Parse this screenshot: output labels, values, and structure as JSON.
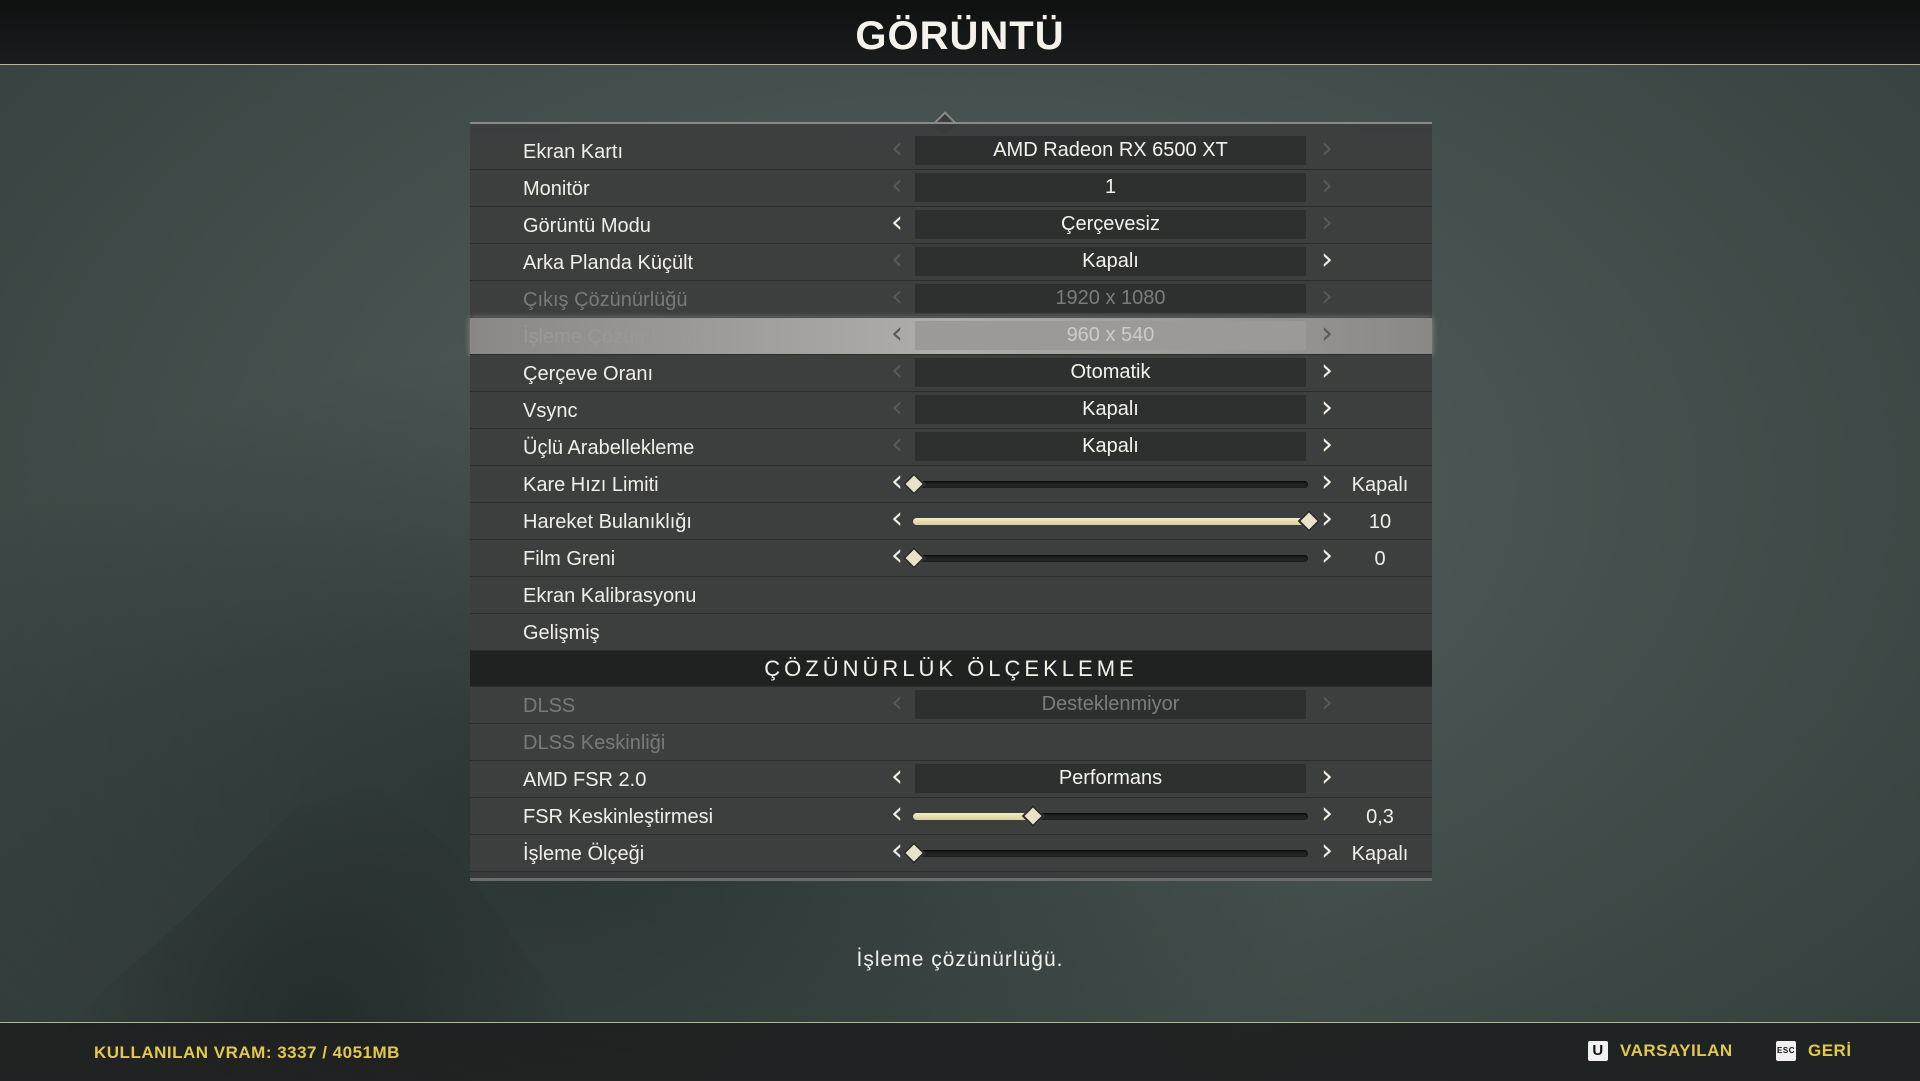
{
  "title": "GÖRÜNTÜ",
  "rows": [
    {
      "label": "Ekran Kartı",
      "value": "AMD Radeon RX 6500 XT"
    },
    {
      "label": "Monitör",
      "value": "1"
    },
    {
      "label": "Görüntü Modu",
      "value": "Çerçevesiz"
    },
    {
      "label": "Arka Planda Küçült",
      "value": "Kapalı"
    },
    {
      "label": "Çıkış Çözünürlüğü",
      "value": "1920 x 1080"
    },
    {
      "label": "İşleme Çözünürlüğü",
      "value": "960 x 540"
    },
    {
      "label": "Çerçeve Oranı",
      "value": "Otomatik"
    },
    {
      "label": "Vsync",
      "value": "Kapalı"
    },
    {
      "label": "Üçlü Arabellekleme",
      "value": "Kapalı"
    },
    {
      "label": "Kare Hızı Limiti",
      "value": "Kapalı",
      "level": 0
    },
    {
      "label": "Hareket Bulanıklığı",
      "value": "10",
      "level": 1.0
    },
    {
      "label": "Film Greni",
      "value": "0",
      "level": 0
    },
    {
      "label": "Ekran Kalibrasyonu"
    },
    {
      "label": "Gelişmiş"
    }
  ],
  "section_title": "ÇÖZÜNÜRLÜK ÖLÇEKLEME",
  "scaling_rows": [
    {
      "label": "DLSS",
      "value": "Desteklenmiyor"
    },
    {
      "label": "DLSS Keskinliği"
    },
    {
      "label": "AMD FSR 2.0",
      "value": "Performans"
    },
    {
      "label": "FSR Keskinleştirmesi",
      "value": "0,3",
      "level": 0.3
    },
    {
      "label": "İşleme Ölçeği",
      "value": "Kapalı",
      "level": 0
    }
  ],
  "hint": "İşleme çözünürlüğü.",
  "footer": {
    "vram": "KULLANILAN VRAM: 3337 / 4051MB",
    "default_key": "U",
    "default_label": "VARSAYILAN",
    "back_key": "ESC",
    "back_label": "GERİ"
  },
  "colors": {
    "accent": "#e3c84c",
    "slider_fill": "#f0e8c0"
  }
}
